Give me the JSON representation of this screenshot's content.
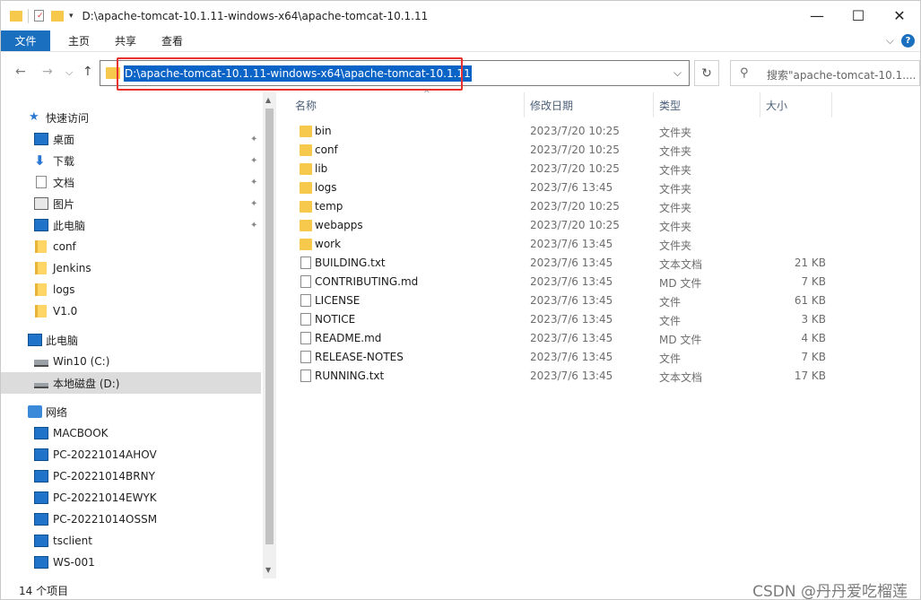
{
  "window": {
    "title": "D:\\apache-tomcat-10.1.11-windows-x64\\apache-tomcat-10.1.11",
    "controls": {
      "minimize": "—",
      "maximize": "☐",
      "close": "✕"
    }
  },
  "ribbon": {
    "tabs": [
      {
        "label": "文件"
      },
      {
        "label": "主页"
      },
      {
        "label": "共享"
      },
      {
        "label": "查看"
      }
    ],
    "expand_icon": "⌵",
    "help_icon": "?"
  },
  "nav": {
    "back": "←",
    "forward": "→",
    "recent": "⌵",
    "up": "↑",
    "address": "D:\\apache-tomcat-10.1.11-windows-x64\\apache-tomcat-10.1.11",
    "address_dropdown": "⌵",
    "refresh": "↻",
    "search_placeholder": "搜索\"apache-tomcat-10.1...."
  },
  "sidebar": {
    "items": [
      {
        "label": "快速访问",
        "icon": "star-icon",
        "pinned": false,
        "level": 0
      },
      {
        "label": "桌面",
        "icon": "desktop-icon",
        "pinned": true,
        "level": 1
      },
      {
        "label": "下载",
        "icon": "download-icon",
        "pinned": true,
        "level": 1
      },
      {
        "label": "文档",
        "icon": "document-icon",
        "pinned": true,
        "level": 1
      },
      {
        "label": "图片",
        "icon": "pictures-icon",
        "pinned": true,
        "level": 1
      },
      {
        "label": "此电脑",
        "icon": "computer-icon",
        "pinned": true,
        "level": 1
      },
      {
        "label": "conf",
        "icon": "folder-icon",
        "pinned": false,
        "level": 1
      },
      {
        "label": "Jenkins",
        "icon": "folder-icon",
        "pinned": false,
        "level": 1
      },
      {
        "label": "logs",
        "icon": "folder-icon",
        "pinned": false,
        "level": 1
      },
      {
        "label": "V1.0",
        "icon": "folder-icon",
        "pinned": false,
        "level": 1
      },
      {
        "label": "此电脑",
        "icon": "computer-icon",
        "pinned": false,
        "level": 0
      },
      {
        "label": "Win10 (C:)",
        "icon": "drive-icon",
        "pinned": false,
        "level": 1
      },
      {
        "label": "本地磁盘 (D:)",
        "icon": "drive-icon",
        "pinned": false,
        "level": 1,
        "selected": true
      },
      {
        "label": "网络",
        "icon": "network-icon",
        "pinned": false,
        "level": 0
      },
      {
        "label": "MACBOOK",
        "icon": "computer-icon",
        "pinned": false,
        "level": 1
      },
      {
        "label": "PC-20221014AHOV",
        "icon": "computer-icon",
        "pinned": false,
        "level": 1
      },
      {
        "label": "PC-20221014BRNY",
        "icon": "computer-icon",
        "pinned": false,
        "level": 1
      },
      {
        "label": "PC-20221014EWYK",
        "icon": "computer-icon",
        "pinned": false,
        "level": 1
      },
      {
        "label": "PC-20221014OSSM",
        "icon": "computer-icon",
        "pinned": false,
        "level": 1
      },
      {
        "label": "tsclient",
        "icon": "computer-icon",
        "pinned": false,
        "level": 1
      },
      {
        "label": "WS-001",
        "icon": "computer-icon",
        "pinned": false,
        "level": 1
      }
    ],
    "pin_icon": "📌"
  },
  "columns": {
    "name": "名称",
    "date": "修改日期",
    "type": "类型",
    "size": "大小",
    "sort_caret": "^"
  },
  "files": [
    {
      "name": "bin",
      "date": "2023/7/20 10:25",
      "type": "文件夹",
      "size": "",
      "kind": "folder"
    },
    {
      "name": "conf",
      "date": "2023/7/20 10:25",
      "type": "文件夹",
      "size": "",
      "kind": "folder"
    },
    {
      "name": "lib",
      "date": "2023/7/20 10:25",
      "type": "文件夹",
      "size": "",
      "kind": "folder"
    },
    {
      "name": "logs",
      "date": "2023/7/6 13:45",
      "type": "文件夹",
      "size": "",
      "kind": "folder"
    },
    {
      "name": "temp",
      "date": "2023/7/20 10:25",
      "type": "文件夹",
      "size": "",
      "kind": "folder"
    },
    {
      "name": "webapps",
      "date": "2023/7/20 10:25",
      "type": "文件夹",
      "size": "",
      "kind": "folder"
    },
    {
      "name": "work",
      "date": "2023/7/6 13:45",
      "type": "文件夹",
      "size": "",
      "kind": "folder"
    },
    {
      "name": "BUILDING.txt",
      "date": "2023/7/6 13:45",
      "type": "文本文档",
      "size": "21 KB",
      "kind": "file"
    },
    {
      "name": "CONTRIBUTING.md",
      "date": "2023/7/6 13:45",
      "type": "MD 文件",
      "size": "7 KB",
      "kind": "file"
    },
    {
      "name": "LICENSE",
      "date": "2023/7/6 13:45",
      "type": "文件",
      "size": "61 KB",
      "kind": "file"
    },
    {
      "name": "NOTICE",
      "date": "2023/7/6 13:45",
      "type": "文件",
      "size": "3 KB",
      "kind": "file"
    },
    {
      "name": "README.md",
      "date": "2023/7/6 13:45",
      "type": "MD 文件",
      "size": "4 KB",
      "kind": "file"
    },
    {
      "name": "RELEASE-NOTES",
      "date": "2023/7/6 13:45",
      "type": "文件",
      "size": "7 KB",
      "kind": "file"
    },
    {
      "name": "RUNNING.txt",
      "date": "2023/7/6 13:45",
      "type": "文本文档",
      "size": "17 KB",
      "kind": "file"
    }
  ],
  "status": {
    "count": "14 个项目",
    "watermark": "CSDN @丹丹爱吃榴莲"
  },
  "colors": {
    "accent": "#1a6fbf",
    "highlight": "#0a64c8",
    "annotation": "#e8312e",
    "folder": "#f6c84c"
  }
}
